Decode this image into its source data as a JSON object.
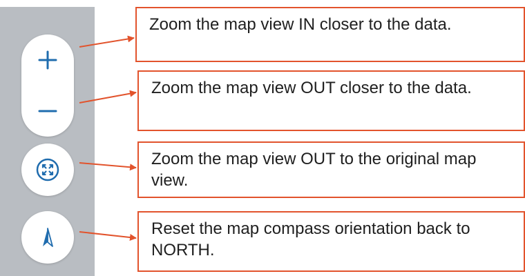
{
  "controls": {
    "zoom_in": {
      "icon": "plus-icon",
      "action": "Zoom the map view IN closer to the data."
    },
    "zoom_out": {
      "icon": "minus-icon",
      "action": "Zoom the map view OUT closer to the data."
    },
    "default_extent": {
      "icon": "expand-arrows-icon",
      "action": "Zoom the map view OUT to the original map view."
    },
    "compass": {
      "icon": "compass-north-icon",
      "action": "Reset the map compass orientation back to NORTH."
    }
  },
  "colors": {
    "sidebar": "#b9bdc2",
    "icon_blue": "#1f6cae",
    "callout_border": "#e2532c",
    "arrow": "#e2532c",
    "text": "#1f1f1f"
  }
}
